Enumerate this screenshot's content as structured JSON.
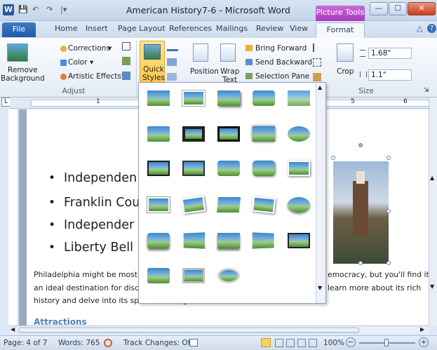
{
  "titlebar": {
    "app_icon": "W",
    "title": "American History7-6 - Microsoft Word",
    "context_tab": "Picture Tools",
    "qat": {
      "save": "💾",
      "undo": "↶",
      "redo": "↷",
      "customize": "|▾"
    }
  },
  "window": {
    "minimize": "—",
    "maximize": "☐",
    "close": "✕"
  },
  "tabs": [
    "File",
    "Home",
    "Insert",
    "Page Layout",
    "References",
    "Mailings",
    "Review",
    "View",
    "Format"
  ],
  "ribbon": {
    "remove_bg": "Remove\nBackground",
    "corrections": "Corrections",
    "color": "Color",
    "artistic": "Artistic Effects",
    "adjust": "Adjust",
    "quick_styles": "Quick\nStyles",
    "position": "Position",
    "wrap_text": "Wrap\nText",
    "bring_forward": "Bring Forward",
    "send_backward": "Send Backward",
    "selection_pane": "Selection Pane",
    "crop": "Crop",
    "height": "1.68\"",
    "width": "1.1\"",
    "size": "Size",
    "dropdown": "▾"
  },
  "ruler": {
    "corner": "L",
    "n1": "1",
    "n5": "5",
    "n6": "6"
  },
  "document": {
    "bullets": [
      "Independen",
      "Franklin Cou",
      "Independer",
      "Liberty Bell"
    ],
    "para_left": [
      "Philadelphia  might be most",
      "an ideal destination for disc",
      "history and delve into its spectacular sights and attractions."
    ],
    "para_right": [
      "emocracy, but you'll find it's",
      "learn more about its rich"
    ],
    "heading": "Attractions"
  },
  "status": {
    "page": "Page: 4 of 7",
    "words": "Words: 765",
    "track": "Track Changes: Off",
    "zoom": "100%",
    "minus": "−",
    "plus": "+"
  },
  "icons": {
    "help": "?",
    "collapse": "△",
    "scroll_up": "▲",
    "scroll_down": "▼",
    "scroll_left": "◀",
    "scroll_right": "▶",
    "launcher": "⇲"
  }
}
